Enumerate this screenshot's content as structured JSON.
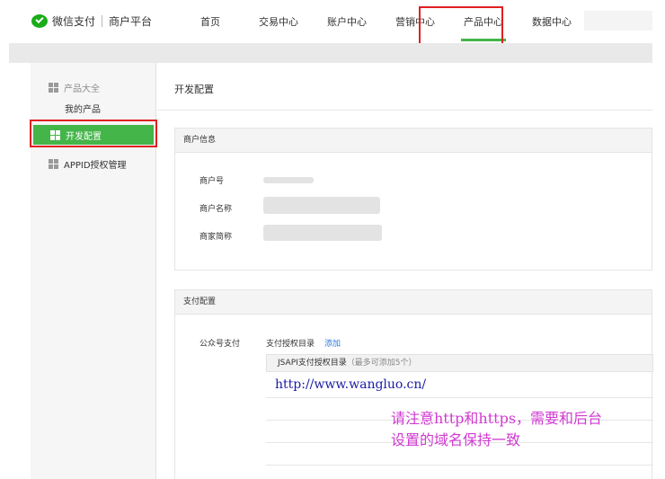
{
  "brand": {
    "name": "微信支付",
    "subtitle": "商户平台"
  },
  "nav": [
    {
      "label": "首页"
    },
    {
      "label": "交易中心"
    },
    {
      "label": "账户中心"
    },
    {
      "label": "营销中心"
    },
    {
      "label": "产品中心",
      "active": true
    },
    {
      "label": "数据中心"
    }
  ],
  "sidebar": {
    "group_label": "产品大全",
    "sub_item": "我的产品",
    "active_item": "开发配置",
    "appid_item": "APPID授权管理"
  },
  "main": {
    "page_title": "开发配置",
    "merchant_panel": {
      "title": "商户信息",
      "rows": [
        {
          "label": "商户号"
        },
        {
          "label": "商户名称"
        },
        {
          "label": "商家简称"
        }
      ]
    },
    "payment_panel": {
      "title": "支付配置",
      "label": "公众号支付",
      "dir_label": "支付授权目录",
      "add_link": "添加",
      "jsapi_title": "JSAPI支付授权目录",
      "jsapi_hint": "（最多可添加5个）",
      "url": "http://www.wangluo.cn/"
    }
  },
  "annotation": {
    "line1": "请注意http和https，需要和后台",
    "line2": "设置的域名保持一致"
  },
  "colors": {
    "accent": "#44b549",
    "highlight": "#e02020",
    "link": "#2a7ae2",
    "note": "#d03ad0"
  }
}
